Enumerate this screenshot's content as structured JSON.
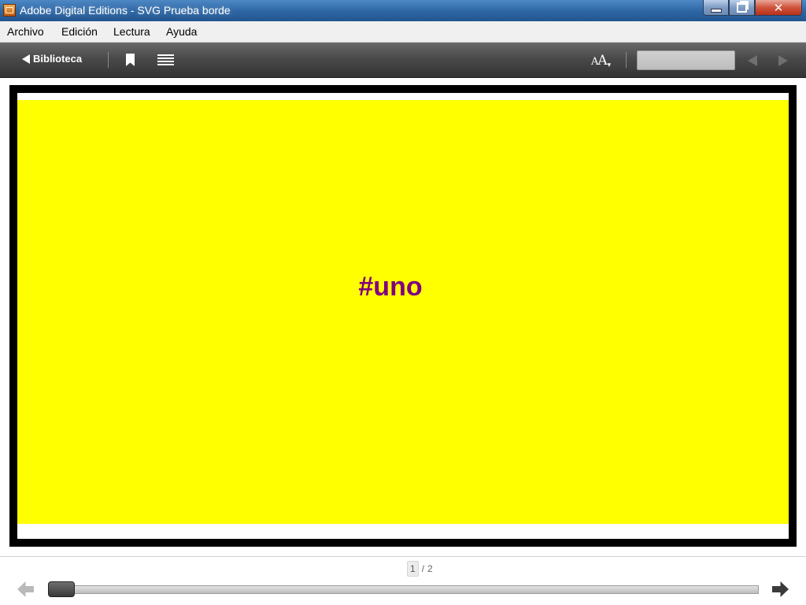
{
  "window": {
    "title": "Adobe Digital Editions - SVG Prueba borde",
    "close_label": "✕"
  },
  "menu": {
    "items": [
      {
        "label": "Archivo"
      },
      {
        "label": "Edición"
      },
      {
        "label": "Lectura"
      },
      {
        "label": "Ayuda"
      }
    ]
  },
  "toolbar": {
    "library_label": "Biblioteca",
    "bookmark_icon": "bookmark-icon",
    "toc_icon": "table-of-contents-icon",
    "font_size_icon": "font-size-icon",
    "search_value": "",
    "prev_icon": "triangle-left-icon",
    "next_icon": "triangle-right-icon"
  },
  "content": {
    "text": "#uno",
    "box_color": "#ffff00",
    "text_color": "#800080",
    "border_color": "#000000"
  },
  "pagination": {
    "current_page": "1",
    "separator": "/",
    "total_pages": "2",
    "progress_fraction": 0
  }
}
